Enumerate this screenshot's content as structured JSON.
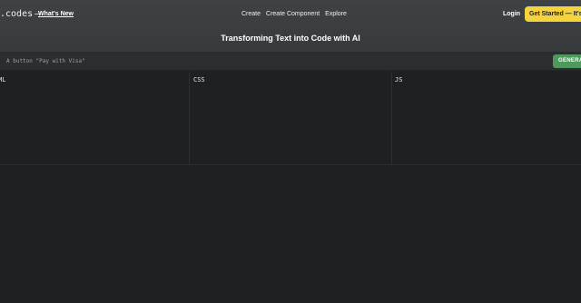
{
  "header": {
    "logo": ".codes",
    "logo_dash": "—",
    "whats_new": "What's New",
    "nav": [
      "Create",
      "Create Component",
      "Explore"
    ],
    "login": "Login",
    "cta": "Get Started — It's Fr"
  },
  "hero": {
    "headline": "Transforming Text into Code with AI"
  },
  "prompt": {
    "placeholder": "A button \"Pay with Visa\"",
    "generate_label": "GENERATE"
  },
  "editors": {
    "html_label": "ML",
    "css_label": "CSS",
    "js_label": "JS"
  },
  "colors": {
    "accent_yellow": "#f5d33a",
    "generate_green": "#4e9a5c",
    "background": "#1e2023"
  }
}
